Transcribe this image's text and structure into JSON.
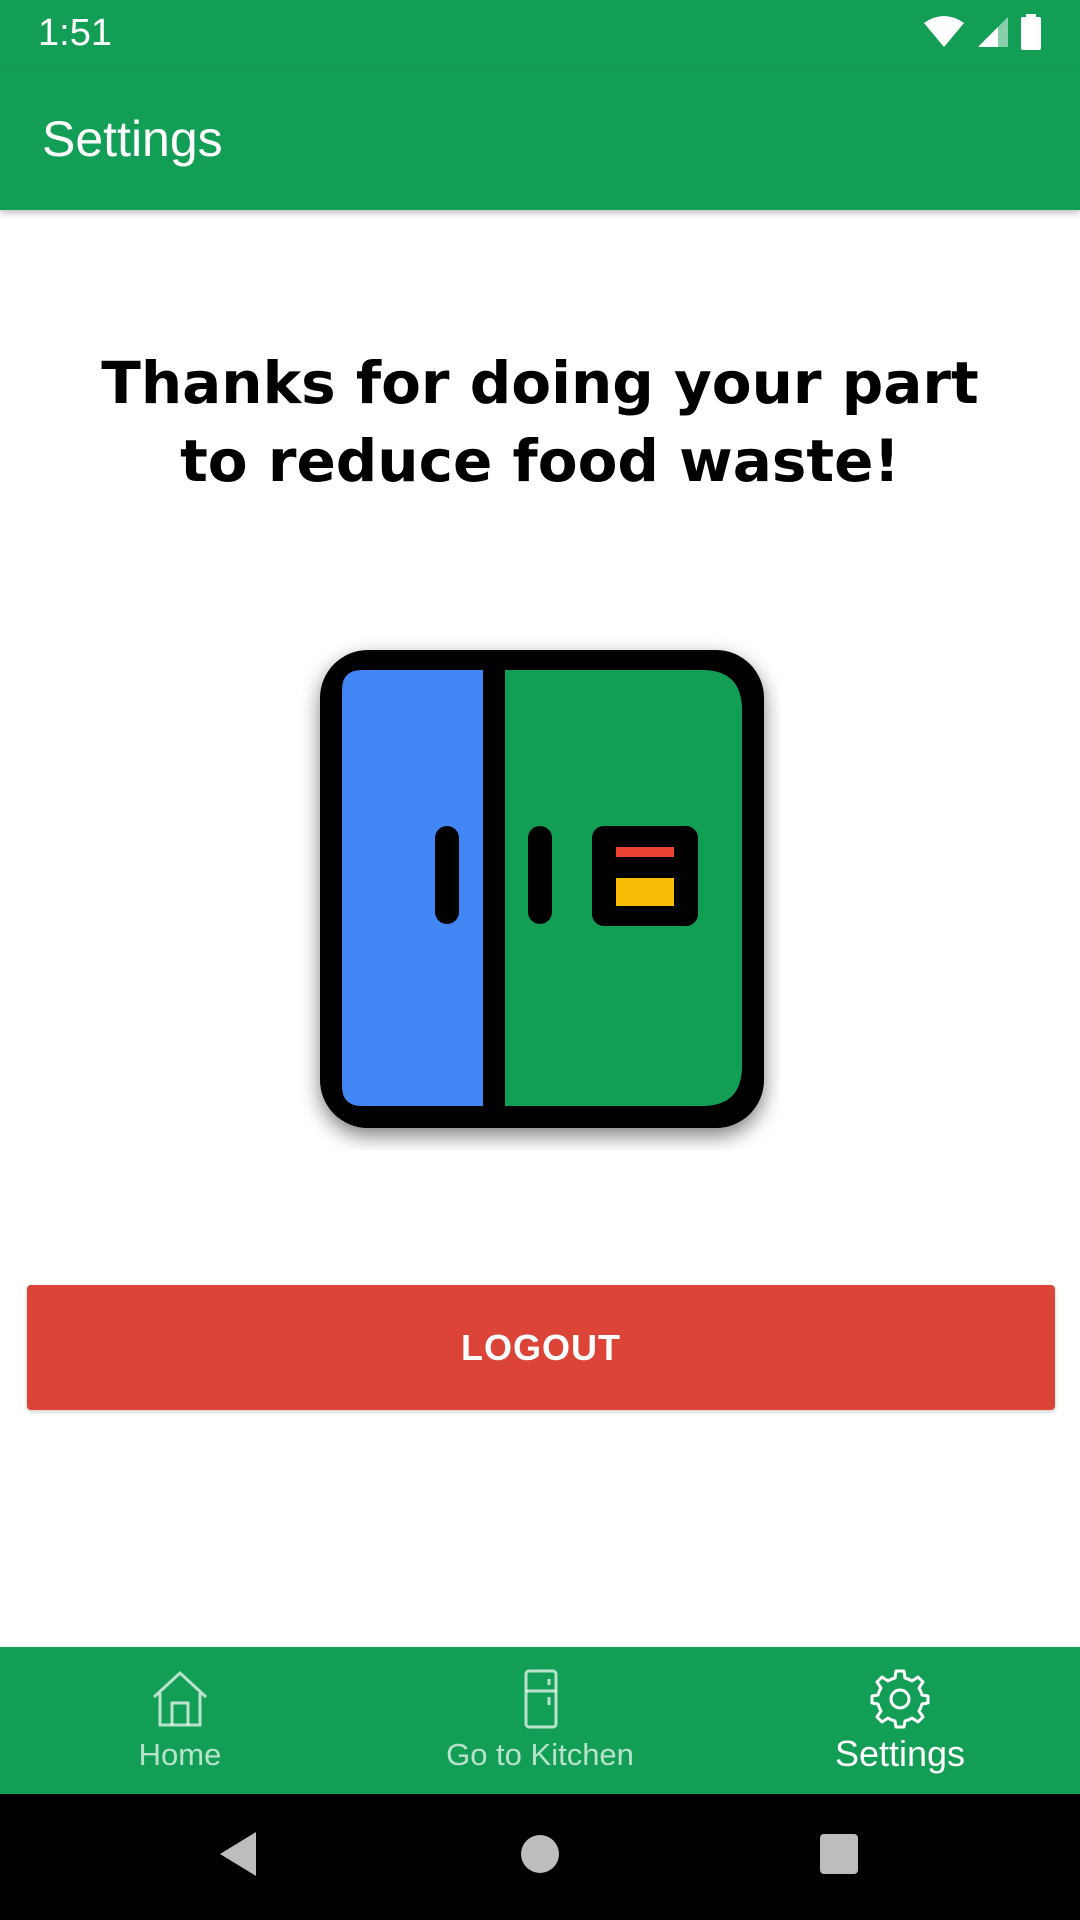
{
  "status": {
    "time": "1:51"
  },
  "app_bar": {
    "title": "Settings"
  },
  "main": {
    "headline": "Thanks for doing your part to reduce food waste!",
    "logout_label": "LOGOUT"
  },
  "bottom_nav": {
    "items": [
      {
        "label": "Home",
        "icon": "home-icon"
      },
      {
        "label": "Go to Kitchen",
        "icon": "fridge-icon"
      },
      {
        "label": "Settings",
        "icon": "gear-icon"
      }
    ],
    "active": "Settings"
  },
  "colors": {
    "primary": "#139e56",
    "logout": "#dc4437",
    "fridge_left": "#4285f4",
    "fridge_right": "#139e56",
    "fridge_stripe_red": "#ea4335",
    "fridge_stripe_yellow": "#fbbc05"
  }
}
